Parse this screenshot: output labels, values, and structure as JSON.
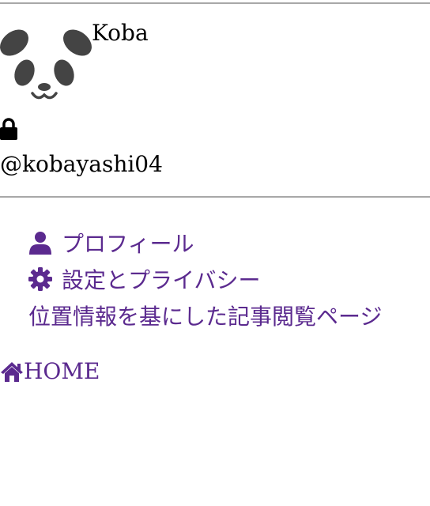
{
  "user": {
    "display_name": "Koba",
    "handle": "@kobayashi04",
    "avatar_icon": "panda-avatar",
    "private_icon": "lock-icon"
  },
  "menu": {
    "items": [
      {
        "label": "プロフィール",
        "icon": "user-icon"
      },
      {
        "label": "設定とプライバシー",
        "icon": "gear-icon"
      },
      {
        "label": "位置情報を基にした記事閲覧ページ",
        "icon": ""
      }
    ]
  },
  "home": {
    "label": "HOME",
    "icon": "home-icon"
  },
  "colors": {
    "link": "#5b2a8f",
    "divider": "#a8a8a8",
    "avatar": "#444444"
  }
}
